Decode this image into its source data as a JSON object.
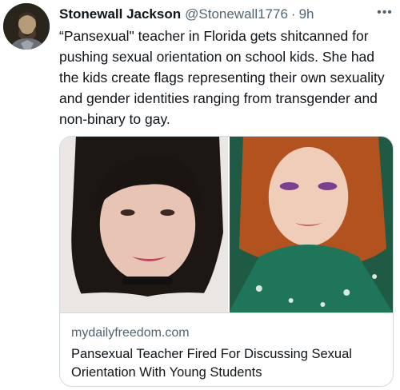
{
  "tweet": {
    "author_name": "Stonewall Jackson",
    "author_handle": "@Stonewall1776",
    "separator": "·",
    "timestamp": "9h",
    "more_label": "•••",
    "text": "“Pansexual\" teacher in Florida gets shitcanned for pushing sexual orientation on school kids. She had the kids create flags representing their own sexuality and gender identities ranging from transgender and non-binary to gay."
  },
  "link_card": {
    "domain": "mydailyfreedom.com",
    "title": "Pansexual Teacher Fired For Discussing Sexual Orientation With Young Students"
  }
}
